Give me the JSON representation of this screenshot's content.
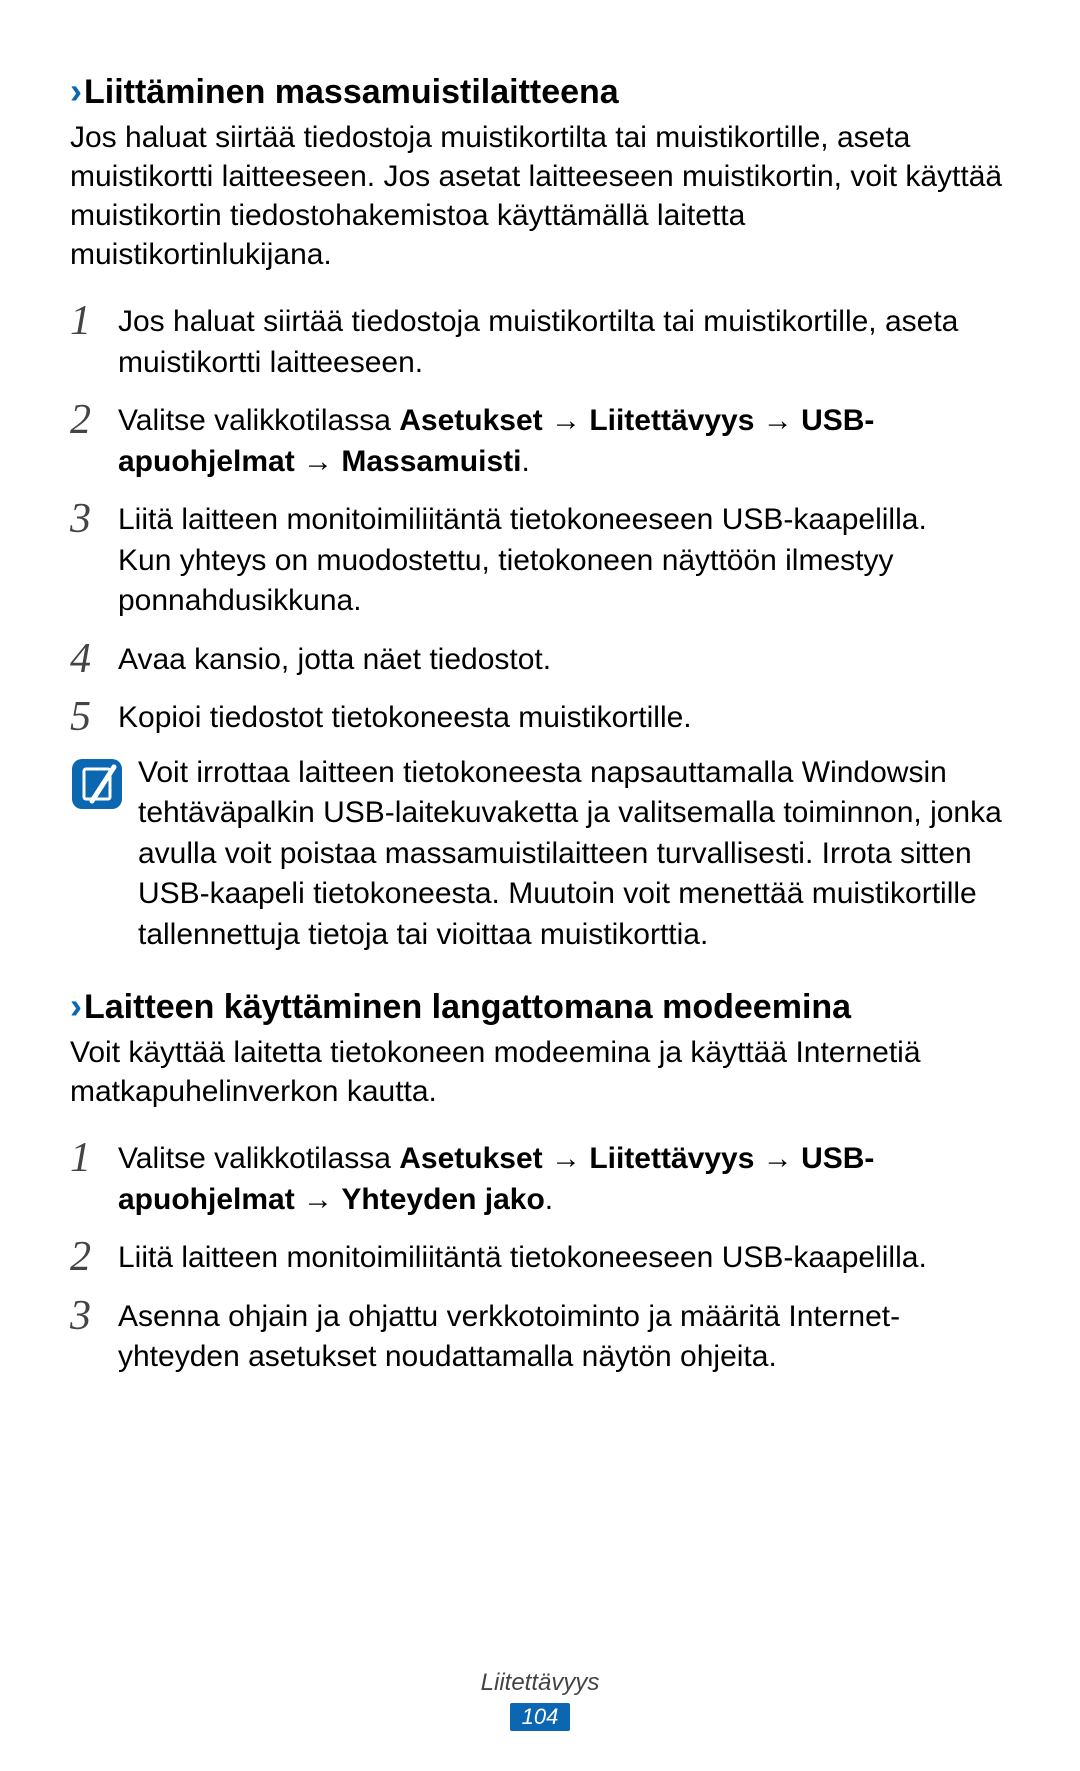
{
  "section1": {
    "heading": "Liittäminen massamuistilaitteena",
    "intro": "Jos haluat siirtää tiedostoja muistikortilta tai muistikortille, aseta muistikortti laitteeseen. Jos asetat laitteeseen muistikortin, voit käyttää muistikortin tiedostohakemistoa käyttämällä laitetta muistikortinlukijana.",
    "steps": {
      "s1": {
        "num": "1",
        "text": "Jos haluat siirtää tiedostoja muistikortilta tai muistikortille, aseta muistikortti laitteeseen."
      },
      "s2": {
        "num": "2",
        "pre": "Valitse valikkotilassa ",
        "b1": "Asetukset",
        "b2": "Liitettävyys",
        "b3": "USB-apuohjelmat",
        "b4": "Massamuisti",
        "arrow": " → "
      },
      "s3": {
        "num": "3",
        "text1": "Liitä laitteen monitoimiliitäntä tietokoneeseen USB-kaapelilla.",
        "text2": "Kun yhteys on muodostettu, tietokoneen näyttöön ilmestyy ponnahdusikkuna."
      },
      "s4": {
        "num": "4",
        "text": "Avaa kansio, jotta näet tiedostot."
      },
      "s5": {
        "num": "5",
        "text": "Kopioi tiedostot tietokoneesta muistikortille."
      }
    },
    "note": "Voit irrottaa laitteen tietokoneesta napsauttamalla Windowsin tehtäväpalkin USB-laitekuvaketta ja valitsemalla toiminnon, jonka avulla voit poistaa massamuistilaitteen turvallisesti. Irrota sitten USB-kaapeli tietokoneesta. Muutoin voit menettää muistikortille tallennettuja tietoja tai vioittaa muistikorttia."
  },
  "section2": {
    "heading": "Laitteen käyttäminen langattomana modeemina",
    "intro": "Voit käyttää laitetta tietokoneen modeemina ja käyttää Internetiä matkapuhelinverkon kautta.",
    "steps": {
      "s1": {
        "num": "1",
        "pre": "Valitse valikkotilassa ",
        "b1": "Asetukset",
        "b2": "Liitettävyys",
        "b3": "USB-apuohjelmat",
        "b4": "Yhteyden jako",
        "arrow": " → "
      },
      "s2": {
        "num": "2",
        "text": "Liitä laitteen monitoimiliitäntä tietokoneeseen USB-kaapelilla."
      },
      "s3": {
        "num": "3",
        "text": "Asenna ohjain ja ohjattu verkkotoiminto ja määritä Internet-yhteyden asetukset noudattamalla näytön ohjeita."
      }
    }
  },
  "footer": {
    "label": "Liitettävyys",
    "page": "104"
  }
}
